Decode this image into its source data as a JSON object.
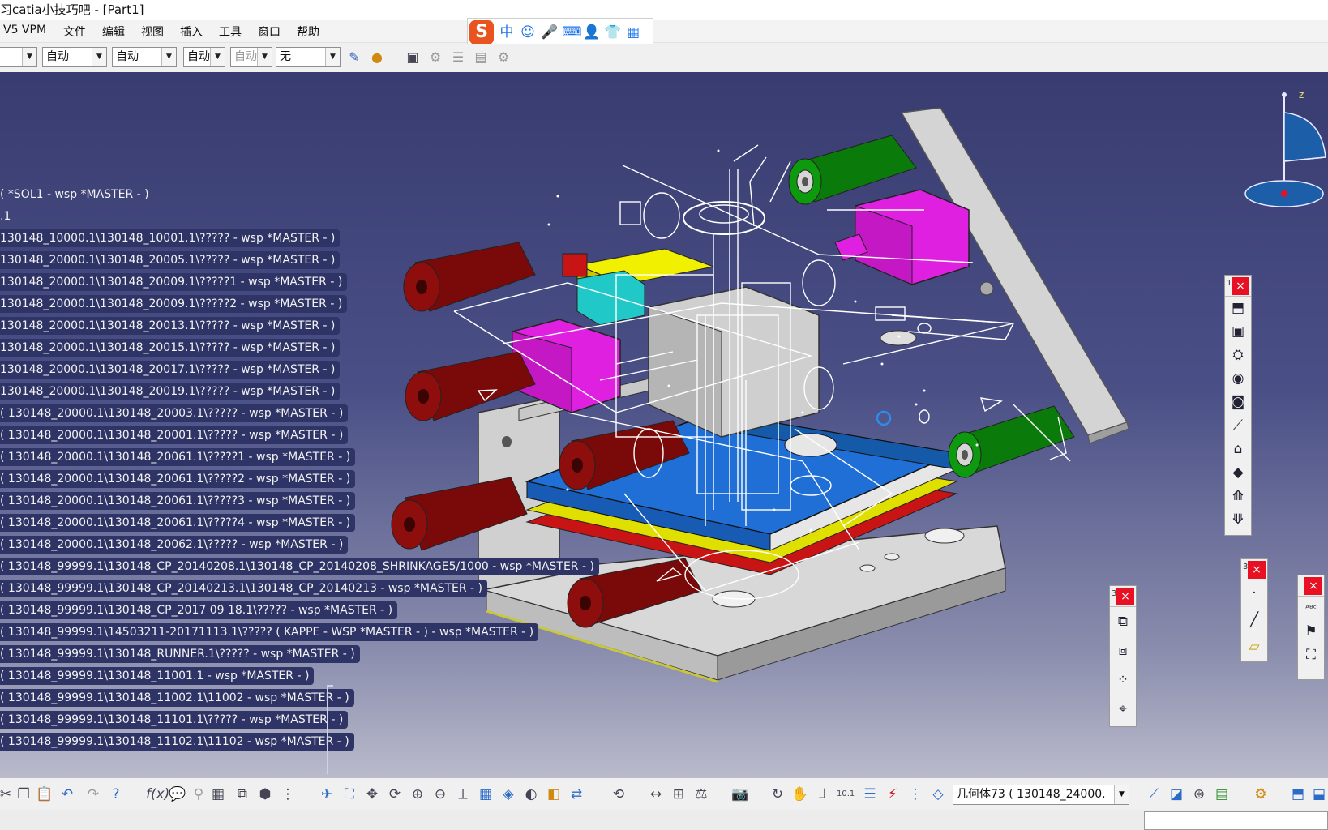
{
  "window": {
    "title": "习catia小技巧吧 - [Part1]"
  },
  "menu": {
    "items": [
      "V5 VPM",
      "文件",
      "编辑",
      "视图",
      "插入",
      "工具",
      "窗口",
      "帮助"
    ]
  },
  "ime": {
    "logo": "S",
    "icons": [
      "中",
      "☺",
      "🎤",
      "⌨",
      "👤",
      "👕",
      "▦"
    ]
  },
  "toolbar1": {
    "combos": [
      {
        "value": "",
        "disabled": false
      },
      {
        "value": "自动",
        "disabled": false
      },
      {
        "value": "自动",
        "disabled": false
      },
      {
        "value": "自动",
        "disabled": false
      },
      {
        "value": "自动",
        "disabled": true
      },
      {
        "value": "无",
        "disabled": false
      }
    ],
    "icons": [
      "paint-brush-icon",
      "material-sphere-icon",
      "new-window-icon",
      "properties-icon",
      "layer-icon",
      "filter-icon",
      "compute-icon"
    ]
  },
  "tree": {
    "nodes": [
      "( *SOL1 - wsp *MASTER - )",
      ".1",
      "130148_10000.1\\130148_10001.1\\????? - wsp *MASTER - )",
      "130148_20000.1\\130148_20005.1\\????? - wsp *MASTER - )",
      "130148_20000.1\\130148_20009.1\\?????1 - wsp *MASTER - )",
      "130148_20000.1\\130148_20009.1\\?????2 - wsp *MASTER - )",
      "130148_20000.1\\130148_20013.1\\????? - wsp *MASTER - )",
      "130148_20000.1\\130148_20015.1\\????? - wsp *MASTER - )",
      "130148_20000.1\\130148_20017.1\\????? - wsp *MASTER - )",
      "130148_20000.1\\130148_20019.1\\????? - wsp *MASTER - )",
      "( 130148_20000.1\\130148_20003.1\\????? - wsp *MASTER - )",
      "( 130148_20000.1\\130148_20001.1\\????? - wsp *MASTER - )",
      "( 130148_20000.1\\130148_20061.1\\?????1 - wsp *MASTER - )",
      "( 130148_20000.1\\130148_20061.1\\?????2 - wsp *MASTER - )",
      "( 130148_20000.1\\130148_20061.1\\?????3 - wsp *MASTER - )",
      "( 130148_20000.1\\130148_20061.1\\?????4 - wsp *MASTER - )",
      "( 130148_20000.1\\130148_20062.1\\????? - wsp *MASTER - )",
      "( 130148_99999.1\\130148_CP_20140208.1\\130148_CP_20140208_SHRINKAGE5/1000 - wsp *MASTER - )",
      "( 130148_99999.1\\130148_CP_20140213.1\\130148_CP_20140213 - wsp *MASTER - )",
      "( 130148_99999.1\\130148_CP_2017 09 18.1\\????? - wsp *MASTER - )",
      "( 130148_99999.1\\14503211-20171113.1\\????? ( KAPPE - WSP *MASTER - ) - wsp *MASTER - )",
      "( 130148_99999.1\\130148_RUNNER.1\\????? - wsp *MASTER - )",
      "( 130148_99999.1\\130148_11001.1 - wsp *MASTER - )",
      "( 130148_99999.1\\130148_11002.1\\11002 - wsp *MASTER - )",
      "( 130148_99999.1\\130148_11101.1\\????? - wsp *MASTER - )",
      "( 130148_99999.1\\130148_11102.1\\11102 - wsp *MASTER - )"
    ]
  },
  "compass": {
    "axis_label": "z"
  },
  "floating_toolbars": [
    {
      "grip": "1",
      "close": "×",
      "icons": [
        "extrude-icon",
        "pocket-icon",
        "shaft-icon",
        "groove-icon",
        "hole-icon",
        "rib-icon",
        "slot-icon",
        "stiffener-icon",
        "loft-icon",
        "remove-loft-icon"
      ]
    },
    {
      "grip": "3",
      "close": "×",
      "icons": [
        "body-icon",
        "operations-icon",
        "pattern-icon",
        "transform-icon"
      ]
    },
    {
      "grip": "3",
      "close": "×",
      "icons": [
        "point-icon",
        "line-icon",
        "plane-icon"
      ]
    },
    {
      "grip": "",
      "close": "×",
      "icons": [
        "text-annotation-icon",
        "flag-note-icon",
        "3d-annotation-icon"
      ]
    }
  ],
  "bottom_toolbar": {
    "icons": [
      "cut-icon",
      "copy-icon",
      "paste-icon",
      "undo-icon",
      "redo-icon",
      "whats-this-icon",
      "formula-icon",
      "knowledge-icon",
      "sketcher-icon",
      "table-icon",
      "catalog-icon",
      "measure-icon",
      "analysis-icon",
      "fly-mode-icon",
      "fit-all-icon",
      "pan-icon",
      "rotate-icon",
      "zoom-in-icon",
      "zoom-out-icon",
      "normal-view-icon",
      "multi-view-icon",
      "iso-view-icon",
      "shading-icon",
      "hide-show-icon",
      "swap-space-icon",
      "update-icon",
      "measure-between-icon",
      "measure-item-icon",
      "mass-icon",
      "capture-icon",
      "refresh-icon",
      "hand-icon",
      "axis-icon",
      "coordinates-icon",
      "stack-icon",
      "constraint-icon",
      "list-icon",
      "plane-icon"
    ],
    "geometry_combo": "几何体73 ( 130148_24000.",
    "right_icons": [
      "sketch-analysis-icon",
      "draft-analysis-icon",
      "curvature-icon",
      "thickness-icon",
      "part-design-icon",
      "wireframe-icon",
      "generative-icon"
    ]
  },
  "colors": {
    "viewport_top": "#383c70",
    "viewport_bottom": "#b9bacb",
    "tree_node_bg": "#2f3466",
    "close_button": "#e81123",
    "plate_blue": "#1f6fd6",
    "plate_yellow": "#e0e000",
    "plate_red": "#c81414",
    "cylinder_darkred": "#7a0a0a",
    "cylinder_green": "#0a7a0a",
    "block_magenta": "#e020e0",
    "block_cyan": "#20c8c8"
  }
}
